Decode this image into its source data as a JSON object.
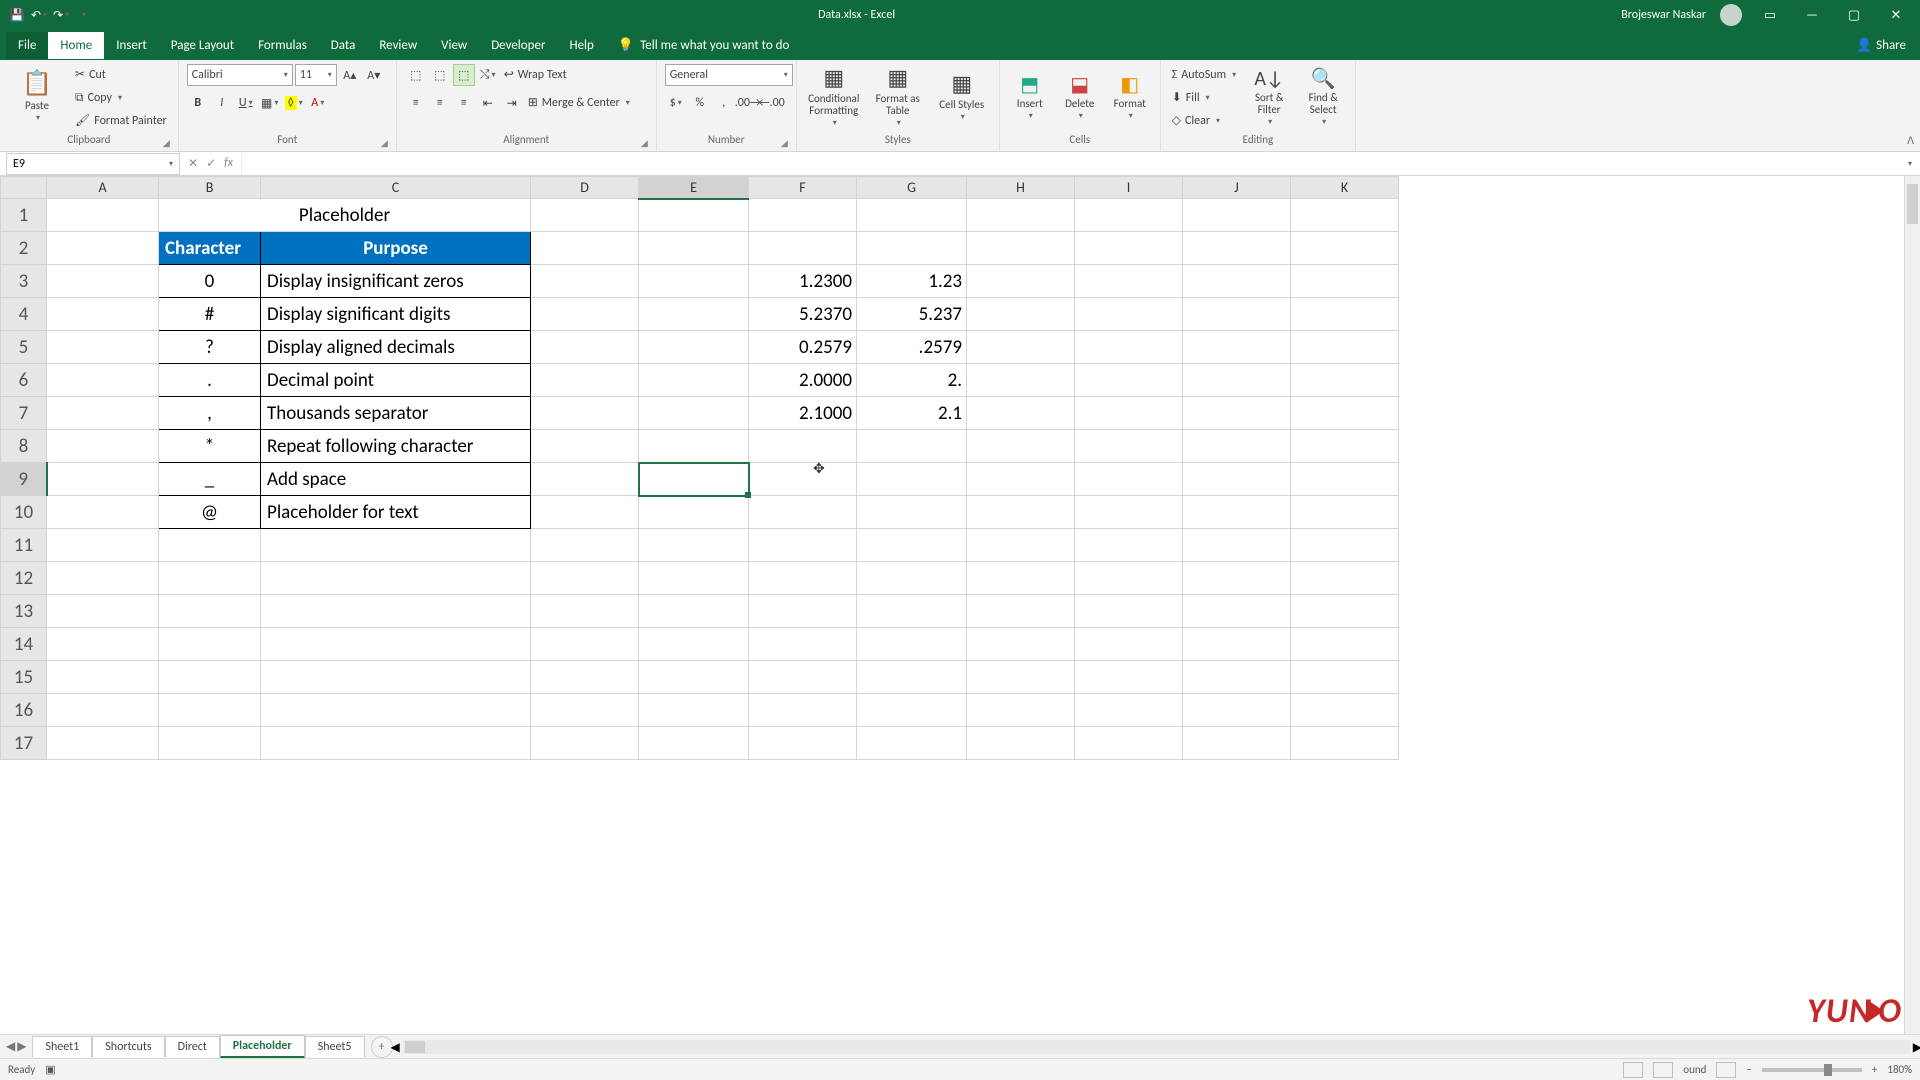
{
  "title": "Data.xlsx - Excel",
  "user": "Brojeswar Naskar",
  "tabs": [
    "File",
    "Home",
    "Insert",
    "Page Layout",
    "Formulas",
    "Data",
    "Review",
    "View",
    "Developer",
    "Help"
  ],
  "active_tab": "Home",
  "tell_me": "Tell me what you want to do",
  "share": "Share",
  "clipboard": {
    "paste": "Paste",
    "cut": "Cut",
    "copy": "Copy",
    "painter": "Format Painter",
    "label": "Clipboard"
  },
  "font": {
    "name": "Calibri",
    "size": "11",
    "label": "Font"
  },
  "alignment": {
    "wrap": "Wrap Text",
    "merge": "Merge & Center",
    "label": "Alignment"
  },
  "number": {
    "format": "General",
    "label": "Number"
  },
  "styles": {
    "cond": "Conditional Formatting",
    "table": "Format as Table",
    "cell": "Cell Styles",
    "label": "Styles"
  },
  "cells": {
    "insert": "Insert",
    "delete": "Delete",
    "format": "Format",
    "label": "Cells"
  },
  "editing": {
    "autosum": "AutoSum",
    "fill": "Fill",
    "clear": "Clear",
    "sort": "Sort & Filter",
    "find": "Find & Select",
    "label": "Editing"
  },
  "namebox": "E9",
  "formula": "",
  "columns": [
    "A",
    "B",
    "C",
    "D",
    "E",
    "F",
    "G",
    "H",
    "I",
    "J",
    "K"
  ],
  "rows": [
    "1",
    "2",
    "3",
    "4",
    "5",
    "6",
    "7",
    "8",
    "9",
    "10",
    "11",
    "12",
    "13",
    "14",
    "15",
    "16",
    "17"
  ],
  "sheet": {
    "title": "Placeholder",
    "h1": "Character",
    "h2": "Purpose",
    "r": [
      {
        "c": "0",
        "p": "Display insignificant zeros"
      },
      {
        "c": "#",
        "p": "Display significant digits"
      },
      {
        "c": "?",
        "p": "Display aligned decimals"
      },
      {
        "c": ".",
        "p": "Decimal point"
      },
      {
        "c": ",",
        "p": "Thousands separator"
      },
      {
        "c": "*",
        "p": "Repeat following character"
      },
      {
        "c": "_",
        "p": "Add space"
      },
      {
        "c": "@",
        "p": "Placeholder for text"
      }
    ],
    "f": [
      "1.2300",
      "5.2370",
      "0.2579",
      "2.0000",
      "2.1000"
    ],
    "g": [
      "1.23",
      "5.237",
      ".2579",
      "2.",
      "2.1"
    ]
  },
  "sheet_tabs": [
    "Sheet1",
    "Shortcuts",
    "Direct",
    "Placeholder",
    "Sheet5"
  ],
  "active_sheet": "Placeholder",
  "status": "Ready",
  "zoom": "180%",
  "logo": "YUNO"
}
